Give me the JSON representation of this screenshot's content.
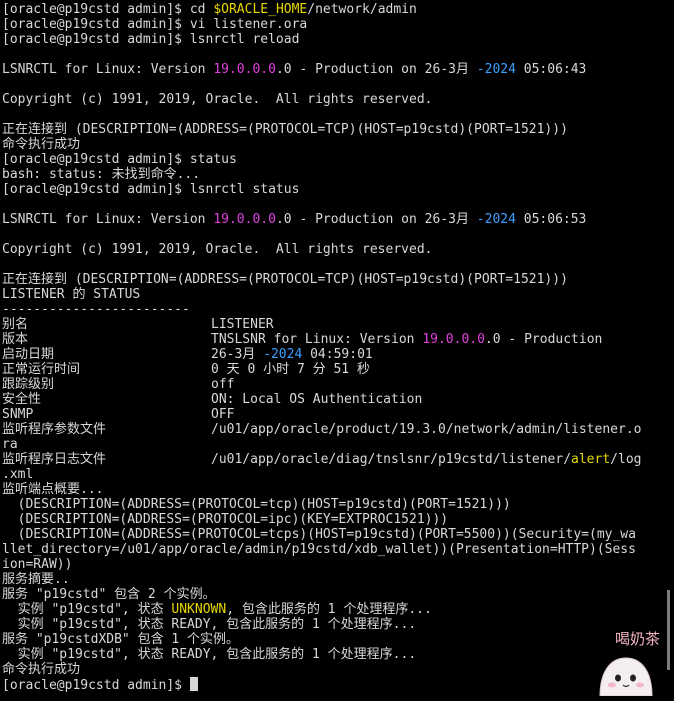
{
  "terminal": {
    "lines": [
      [
        [
          "[oracle@p19cstd admin]$ cd ",
          ""
        ],
        [
          "$ORACLE_HOME",
          "yel"
        ],
        [
          "/network/admin",
          ""
        ]
      ],
      [
        [
          "[oracle@p19cstd admin]$ vi listener.ora",
          ""
        ]
      ],
      [
        [
          "[oracle@p19cstd admin]$ lsnrctl reload",
          ""
        ]
      ],
      [
        [
          "",
          ""
        ]
      ],
      [
        [
          "LSNRCTL for Linux: Version ",
          ""
        ],
        [
          "19.0.0.0",
          "mag"
        ],
        [
          ".0 - Production on 26-3月 ",
          ""
        ],
        [
          "-2024",
          "cyan"
        ],
        [
          " 05:06:43",
          ""
        ]
      ],
      [
        [
          "",
          ""
        ]
      ],
      [
        [
          "Copyright (c) 1991, 2019, Oracle.  All rights reserved.",
          ""
        ]
      ],
      [
        [
          "",
          ""
        ]
      ],
      [
        [
          "正在连接到 (DESCRIPTION=(ADDRESS=(PROTOCOL=TCP)(HOST=p19cstd)(PORT=1521)))",
          ""
        ]
      ],
      [
        [
          "命令执行成功",
          ""
        ]
      ],
      [
        [
          "[oracle@p19cstd admin]$ status",
          ""
        ]
      ],
      [
        [
          "bash: status: 未找到命令...",
          ""
        ]
      ],
      [
        [
          "[oracle@p19cstd admin]$ lsnrctl status",
          ""
        ]
      ],
      [
        [
          "",
          ""
        ]
      ],
      [
        [
          "LSNRCTL for Linux: Version ",
          ""
        ],
        [
          "19.0.0.0",
          "mag"
        ],
        [
          ".0 - Production on 26-3月 ",
          ""
        ],
        [
          "-2024",
          "cyan"
        ],
        [
          " 05:06:53",
          ""
        ]
      ],
      [
        [
          "",
          ""
        ]
      ],
      [
        [
          "Copyright (c) 1991, 2019, Oracle.  All rights reserved.",
          ""
        ]
      ],
      [
        [
          "",
          ""
        ]
      ],
      [
        [
          "正在连接到 (DESCRIPTION=(ADDRESS=(PROTOCOL=TCP)(HOST=p19cstd)(PORT=1521)))",
          ""
        ]
      ],
      [
        [
          "LISTENER 的 STATUS",
          ""
        ]
      ],
      [
        [
          "------------------------",
          ""
        ]
      ]
    ],
    "kv_rows": [
      {
        "key": "别名",
        "value": [
          [
            "LISTENER",
            ""
          ]
        ]
      },
      {
        "key": "版本",
        "value": [
          [
            "TNSLSNR for Linux: Version ",
            ""
          ],
          [
            "19.0.0.0",
            "mag"
          ],
          [
            ".0 - Production",
            ""
          ]
        ]
      },
      {
        "key": "启动日期",
        "value": [
          [
            "26-3月 ",
            ""
          ],
          [
            "-2024",
            "cyan"
          ],
          [
            " 04:59:01",
            ""
          ]
        ]
      },
      {
        "key": "正常运行时间",
        "value": [
          [
            "0 天 0 小时 7 分 51 秒",
            ""
          ]
        ]
      },
      {
        "key": "跟踪级别",
        "value": [
          [
            "off",
            ""
          ]
        ]
      },
      {
        "key": "安全性",
        "value": [
          [
            "ON: Local OS Authentication",
            ""
          ]
        ]
      },
      {
        "key": "SNMP",
        "value": [
          [
            "OFF",
            ""
          ]
        ]
      },
      {
        "key": "监听程序参数文件",
        "value": [
          [
            "/u01/app/oracle/product/19.3.0/network/admin/listener.o",
            ""
          ]
        ]
      },
      {
        "key": "",
        "value": [],
        "raw": [
          [
            "ra",
            ""
          ]
        ]
      },
      {
        "key": "监听程序日志文件",
        "value": [
          [
            "/u01/app/oracle/diag/tnslsnr/p19cstd/listener/",
            ""
          ],
          [
            "alert",
            "yel"
          ],
          [
            "/log",
            ""
          ]
        ]
      },
      {
        "key": "",
        "value": [],
        "raw": [
          [
            ".xml",
            ""
          ]
        ]
      }
    ],
    "tail_lines": [
      [
        [
          "监听端点概要...",
          ""
        ]
      ],
      [
        [
          "  (DESCRIPTION=(ADDRESS=(PROTOCOL=tcp)(HOST=p19cstd)(PORT=1521)))",
          ""
        ]
      ],
      [
        [
          "  (DESCRIPTION=(ADDRESS=(PROTOCOL=ipc)(KEY=EXTPROC1521)))",
          ""
        ]
      ],
      [
        [
          "  (DESCRIPTION=(ADDRESS=(PROTOCOL=tcps)(HOST=p19cstd)(PORT=5500))(Security=(my_wa",
          ""
        ]
      ],
      [
        [
          "llet_directory=/u01/app/oracle/admin/p19cstd/xdb_wallet))(Presentation=HTTP)(Sess",
          ""
        ]
      ],
      [
        [
          "ion=RAW))",
          ""
        ]
      ],
      [
        [
          "服务摘要..",
          ""
        ]
      ],
      [
        [
          "服务 \"p19cstd\" 包含 2 个实例。",
          ""
        ]
      ],
      [
        [
          "  实例 \"p19cstd\", 状态 ",
          ""
        ],
        [
          "UNKNOWN",
          "yel"
        ],
        [
          ", 包含此服务的 1 个处理程序...",
          ""
        ]
      ],
      [
        [
          "  实例 \"p19cstd\", 状态 READY, 包含此服务的 1 个处理程序...",
          ""
        ]
      ],
      [
        [
          "服务 \"p19cstdXDB\" 包含 1 个实例。",
          ""
        ]
      ],
      [
        [
          "  实例 \"p19cstd\", 状态 READY, 包含此服务的 1 个处理程序...",
          ""
        ]
      ],
      [
        [
          "命令执行成功",
          ""
        ]
      ]
    ],
    "prompt": "[oracle@p19cstd admin]$ "
  },
  "watermark": {
    "text": "喝奶茶"
  },
  "colors": {
    "background": "#000000",
    "foreground": "#d8d8d8",
    "magenta": "#e040e0",
    "cyan": "#3aa0ff",
    "yellow": "#e8d800"
  }
}
